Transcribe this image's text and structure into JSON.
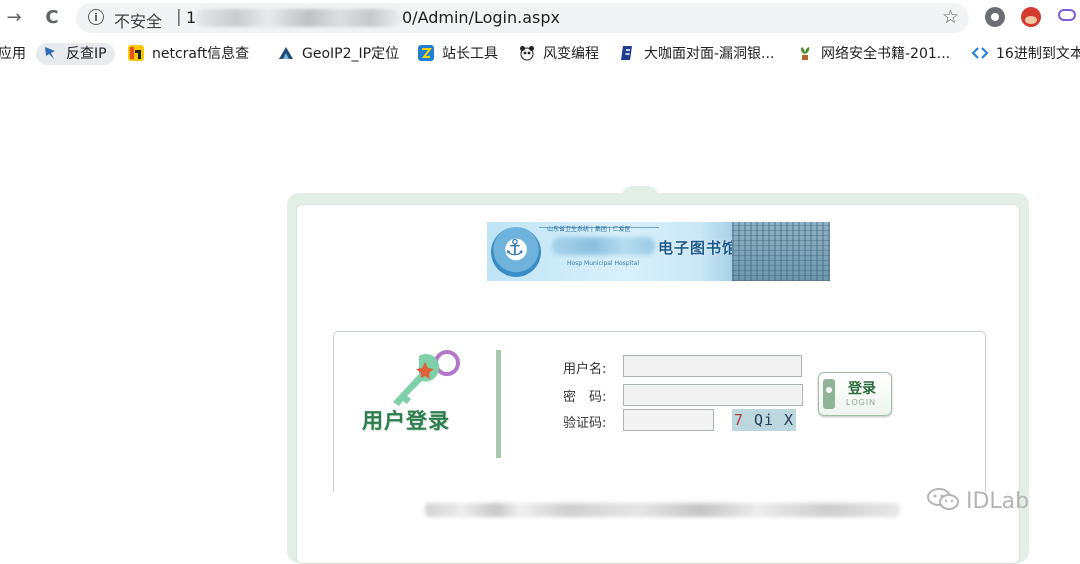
{
  "browser": {
    "back_icon": "→",
    "reload_icon": "C",
    "info_icon": "i",
    "insecure_label": "不安全",
    "separator": "|",
    "host_prefix": "1",
    "url_path": "0/Admin/Login.aspx",
    "star_icon": "☆"
  },
  "bookmarks": [
    {
      "label": "应用",
      "icon": "apps-icon",
      "color": "#4285f4"
    },
    {
      "label": "反查IP",
      "icon": "feather-icon",
      "color": "#2f6db3"
    },
    {
      "label": "netcraft信息查",
      "icon": "netcraft-icon",
      "color": "#e94e1b"
    },
    {
      "label": "GeoIP2_IP定位",
      "icon": "maxmind-icon",
      "color": "#1e4d7a"
    },
    {
      "label": "站长工具",
      "icon": "chinaz-icon",
      "color": "#1e7fd6"
    },
    {
      "label": "风变编程",
      "icon": "panda-icon",
      "color": "#222222"
    },
    {
      "label": "大咖面对面-漏洞银...",
      "icon": "butian-icon",
      "color": "#1f3d8f"
    },
    {
      "label": "网络安全书籍-201...",
      "icon": "plant-icon",
      "color": "#4d8a2a"
    },
    {
      "label": "16进制到文本",
      "icon": "code-icon",
      "color": "#2a82d8"
    }
  ],
  "banner": {
    "title": "电子图书馆",
    "subtitle": "Hosp Municipal Hospital",
    "motto": "山东省卫生系统 | 集团 | 仁爱医"
  },
  "login": {
    "panel_title": "用户登录",
    "username_label": "用户名:",
    "password_label": "密　码:",
    "captcha_label": "验证码:",
    "username_value": "",
    "password_value": "",
    "captcha_input_value": "",
    "captcha_first": "7",
    "captcha_rest": " Qi X",
    "button_label": "登录",
    "button_sublabel": "LOGIN"
  },
  "watermark": {
    "text": "IDLab"
  },
  "colors": {
    "accent_green": "#2f7d4f",
    "frame_green": "#e3efe6",
    "captcha_bg": "#bcd8de"
  }
}
